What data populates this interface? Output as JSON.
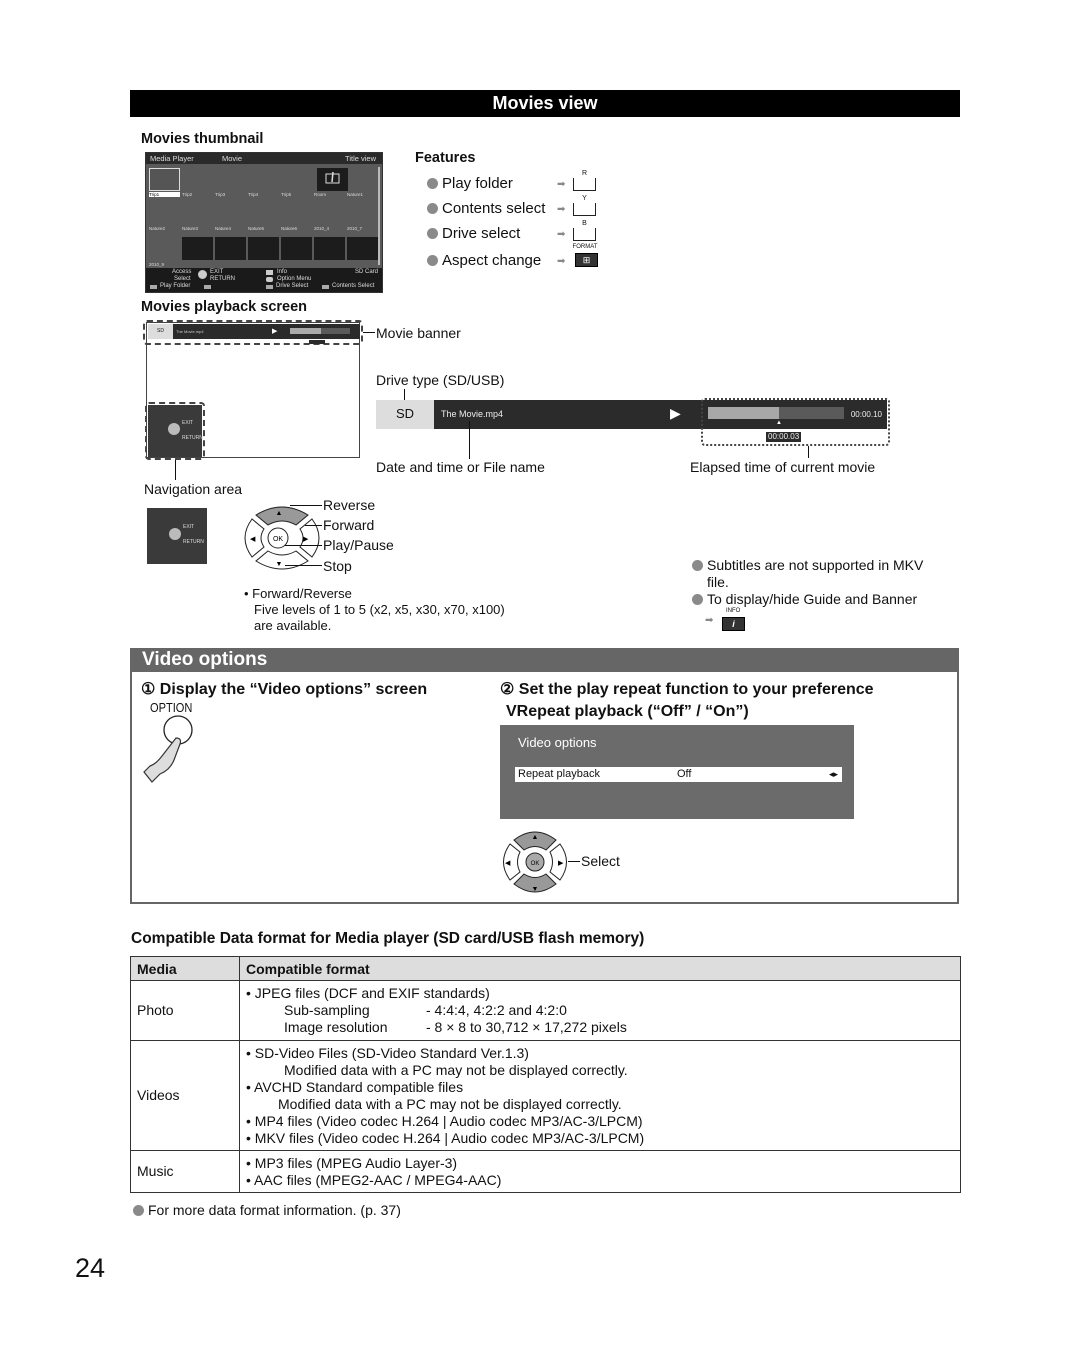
{
  "movies_view": {
    "title": "Movies view",
    "thumbnail": {
      "heading": "Movies thumbnail",
      "screen": {
        "app": "Media Player",
        "mode": "Movie",
        "view": "Title view",
        "row1": [
          "Trip1",
          "Trip2",
          "Trip3",
          "Trip4",
          "Trip5",
          "Room",
          "Nature1"
        ],
        "row2": [
          "Nature2",
          "Nature3",
          "Nature4",
          "Nature5",
          "Nature6",
          "2010_4",
          "2010_7"
        ],
        "row3": [
          "2010_9"
        ],
        "footer": {
          "access": "Access",
          "select": "Select",
          "exit": "EXIT",
          "return": "RETURN",
          "info": "Info",
          "option_menu": "Option Menu",
          "drive": "SD Card",
          "play_folder": "Play Folder",
          "drive_select": "Drive Select",
          "contents_select": "Contents Select"
        }
      }
    },
    "features": {
      "heading": "Features",
      "items": [
        {
          "label": "Play folder",
          "key": "R"
        },
        {
          "label": "Contents select",
          "key": "Y"
        },
        {
          "label": "Drive select",
          "key": "B"
        },
        {
          "label": "Aspect change",
          "key": "FORMAT"
        }
      ]
    },
    "playback": {
      "heading": "Movies playback screen",
      "movie_banner_label": "Movie banner",
      "drive_type_label": "Drive type (SD/USB)",
      "drive": "SD",
      "file_name": "The Movie.mp4",
      "total_time": "00:00.10",
      "elapsed_time": "00:00.03",
      "progress_fraction": 0.52,
      "date_label": "Date and time or File name",
      "elapsed_label": "Elapsed time of current movie",
      "navigation_area_label": "Navigation area",
      "nav_exit": "EXIT",
      "nav_return": "RETURN"
    },
    "controls": {
      "ok": "OK",
      "reverse": "Reverse",
      "forward": "Forward",
      "play_pause": "Play/Pause",
      "stop": "Stop",
      "note_title": "Forward/Reverse",
      "note_line1": "Five levels of 1 to 5 (x2, x5, x30, x70, x100)",
      "note_line2": "are available."
    },
    "notes": {
      "subtitles": "Subtitles are not supported in MKV",
      "subtitles_2": "file.",
      "guide": "To display/hide Guide and Banner",
      "info_key": "INFO"
    }
  },
  "video_options": {
    "title": "Video options",
    "step1": "① Display the “Video options” screen",
    "option_key": "OPTION",
    "step2": "② Set the play repeat function to your preference",
    "step2_sub": "VRepeat playback (“Off” / “On”)",
    "screen_title": "Video options",
    "row_label": "Repeat playback",
    "row_value": "Off",
    "select_label": "Select",
    "ok": "OK"
  },
  "compat": {
    "title": "Compatible Data format for Media player (SD card/USB flash memory)",
    "headers": [
      "Media",
      "Compatible format"
    ],
    "photo": {
      "media": "Photo",
      "line1": "• JPEG files (DCF and EXIF standards)",
      "sub_k": "Sub-sampling",
      "sub_v": "- 4:4:4, 4:2:2 and 4:2:0",
      "res_k": "Image resolution",
      "res_v": "- 8 × 8 to 30,712 × 17,272 pixels"
    },
    "videos": {
      "media": "Videos",
      "l1": "• SD-Video Files (SD-Video Standard Ver.1.3)",
      "l2": "Modified data with a PC may not be displayed correctly.",
      "l3": "• AVCHD Standard compatible files",
      "l4": "Modified data with a PC may not be displayed correctly.",
      "l5": "• MP4 files (Video codec H.264 | Audio codec MP3/AC-3/LPCM)",
      "l6": "• MKV files (Video codec H.264 | Audio codec MP3/AC-3/LPCM)"
    },
    "music": {
      "media": "Music",
      "l1": "• MP3 files (MPEG Audio Layer-3)",
      "l2": "• AAC files (MPEG2-AAC / MPEG4-AAC)"
    },
    "footnote": "For more data format information. (p. 37)"
  },
  "page_number": "24"
}
